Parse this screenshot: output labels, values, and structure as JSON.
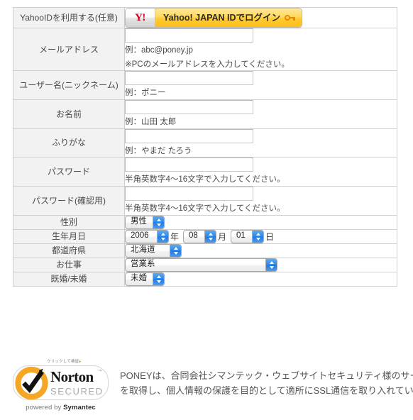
{
  "form": {
    "rows": [
      {
        "id": "yahoo-id",
        "label": "YahooIDを利用する(任意)",
        "type": "yahoo-button",
        "button": {
          "logo": "Y!",
          "text": "Yahoo! JAPAN IDでログイン",
          "icon": "key-icon"
        }
      },
      {
        "id": "email",
        "label": "メールアドレス",
        "type": "text",
        "value": "",
        "hints": [
          "例：abc@poney.jp",
          "※PCのメールアドレスを入力してください。"
        ]
      },
      {
        "id": "username",
        "label": "ユーザー名(ニックネーム)",
        "type": "text",
        "value": "",
        "hints": [
          "例：ポニー"
        ]
      },
      {
        "id": "fullname",
        "label": "お名前",
        "type": "text",
        "value": "",
        "hints": [
          "例：山田 太郎"
        ]
      },
      {
        "id": "furigana",
        "label": "ふりがな",
        "type": "text",
        "value": "",
        "hints": [
          "例：やまだ たろう"
        ]
      },
      {
        "id": "password",
        "label": "パスワード",
        "type": "text",
        "value": "",
        "hints": [
          "半角英数字4〜16文字で入力してください。"
        ]
      },
      {
        "id": "password-confirm",
        "label": "パスワード(確認用)",
        "type": "text",
        "value": "",
        "hints": [
          "半角英数字4〜16文字で入力してください。"
        ]
      },
      {
        "id": "gender",
        "label": "性別",
        "type": "select",
        "selected": "男性"
      },
      {
        "id": "birthday",
        "label": "生年月日",
        "type": "date",
        "year": "2006",
        "year_unit": "年",
        "month": "08",
        "month_unit": "月",
        "day": "01",
        "day_unit": "日"
      },
      {
        "id": "prefecture",
        "label": "都道府県",
        "type": "select",
        "selected": "北海道"
      },
      {
        "id": "job",
        "label": "お仕事",
        "type": "select",
        "selected": "営業系"
      },
      {
        "id": "marital",
        "label": "既婚/未婚",
        "type": "select",
        "selected": "未婚"
      }
    ]
  },
  "ssl": {
    "badge": {
      "hint": "クリックして検証",
      "hint_arrow": "▸",
      "word_primary": "Norton",
      "word_secondary": "SECURED",
      "trademark": "™",
      "powered_prefix": "powered by ",
      "powered_brand": "Symantec"
    },
    "text_lines": [
      "PONEYは、合同会社シマンテック・ウェブサイトセキュリティ様のサーバー証明書",
      "を取得し、個人情報の保護を目的として適所にSSL通信を取り入れています。"
    ]
  },
  "colors": {
    "label_bg": "#f2f2f2",
    "border": "#cfcfcf",
    "yahoo_red": "#d4001a",
    "yahoo_yellow": "#ffcb33",
    "select_arrow_blue": "#2f86e8",
    "norton_orange": "#f5a623",
    "text": "#4a4a4a"
  }
}
